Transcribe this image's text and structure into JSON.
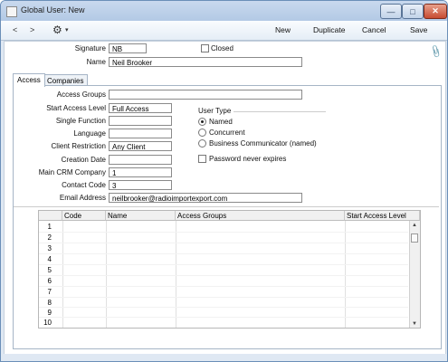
{
  "window": {
    "title": "Global User: New",
    "min": "—",
    "max": "□",
    "close": "✕"
  },
  "toolbar": {
    "back": "<",
    "forward": ">",
    "gear": "⚙",
    "caret": "▾",
    "new_label": "New",
    "duplicate_label": "Duplicate",
    "cancel_label": "Cancel",
    "save_label": "Save"
  },
  "header": {
    "signature_label": "Signature",
    "signature_value": "NB",
    "name_label": "Name",
    "name_value": "Neil Brooker",
    "closed_label": "Closed"
  },
  "tabs": [
    {
      "label": "Access",
      "active": true
    },
    {
      "label": "Companies",
      "active": false
    }
  ],
  "access": {
    "access_groups_label": "Access Groups",
    "access_groups_value": "",
    "start_access_level_label": "Start Access Level",
    "start_access_level_value": "Full Access",
    "single_function_label": "Single Function",
    "single_function_value": "",
    "language_label": "Language",
    "language_value": "",
    "client_restriction_label": "Client Restriction",
    "client_restriction_value": "Any Client",
    "creation_date_label": "Creation Date",
    "creation_date_value": "",
    "main_crm_company_label": "Main CRM Company",
    "main_crm_company_value": "1",
    "contact_code_label": "Contact Code",
    "contact_code_value": "3",
    "email_label": "Email Address",
    "email_value": "neilbrooker@radioimportexport.com",
    "user_type_label": "User Type",
    "user_type_options": [
      "Named",
      "Concurrent",
      "Business Communicator (named)"
    ],
    "user_type_selected": "Named",
    "password_never_expires_label": "Password never expires"
  },
  "grid": {
    "columns": [
      "Code",
      "Name",
      "Access Groups",
      "Start Access Level"
    ],
    "row_numbers": [
      "1",
      "2",
      "3",
      "4",
      "5",
      "6",
      "7",
      "8",
      "9",
      "10"
    ],
    "scroll_up": "▲",
    "scroll_down": "▼"
  },
  "colors": {
    "title_bar": "#b3c9e5",
    "close_button": "#c74b31",
    "frame": "#dfe8f3"
  }
}
